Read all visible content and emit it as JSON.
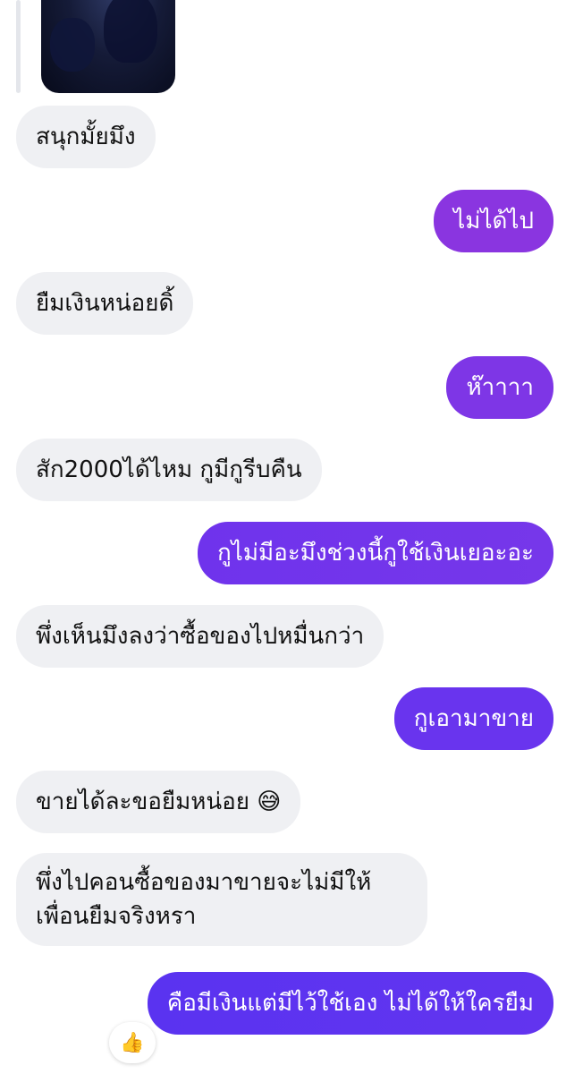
{
  "conversation": {
    "messages": [
      {
        "side": "incoming",
        "text": "สนุกมั้ยมึง"
      },
      {
        "side": "outgoing",
        "text": "ไม่ได้ไป"
      },
      {
        "side": "incoming",
        "text": "ยืมเงินหน่อยดิ้"
      },
      {
        "side": "outgoing",
        "text": "ห๊าาาา"
      },
      {
        "side": "incoming",
        "text": "สัก2000ได้ไหม กูมีกูรีบคืน"
      },
      {
        "side": "outgoing",
        "text": "กูไม่มีอะมึงช่วงนี้กูใช้เงินเยอะอะ"
      },
      {
        "side": "incoming",
        "text": "พึ่งเห็นมึงลงว่าซื้อของไปหมื่นกว่า"
      },
      {
        "side": "outgoing",
        "text": "กูเอามาขาย"
      },
      {
        "side": "incoming",
        "text": "ขายได้ละขอยืมหน่อย",
        "emoji": "😅"
      },
      {
        "side": "incoming",
        "lines": [
          "พึ่งไปคอนซื้อของมาขายจะไม่มีให้",
          "เพื่อนยืมจริงหรา"
        ]
      },
      {
        "side": "outgoing",
        "text": "คือมีเงินแต่มีไว้ใช้เอง ไม่ได้ให้ใครยืม",
        "reaction": "👍"
      }
    ]
  },
  "colors": {
    "incoming_bubble": "#eff0f3",
    "outgoing_gradient": [
      "#8a2be2",
      "#5b32f0"
    ]
  }
}
